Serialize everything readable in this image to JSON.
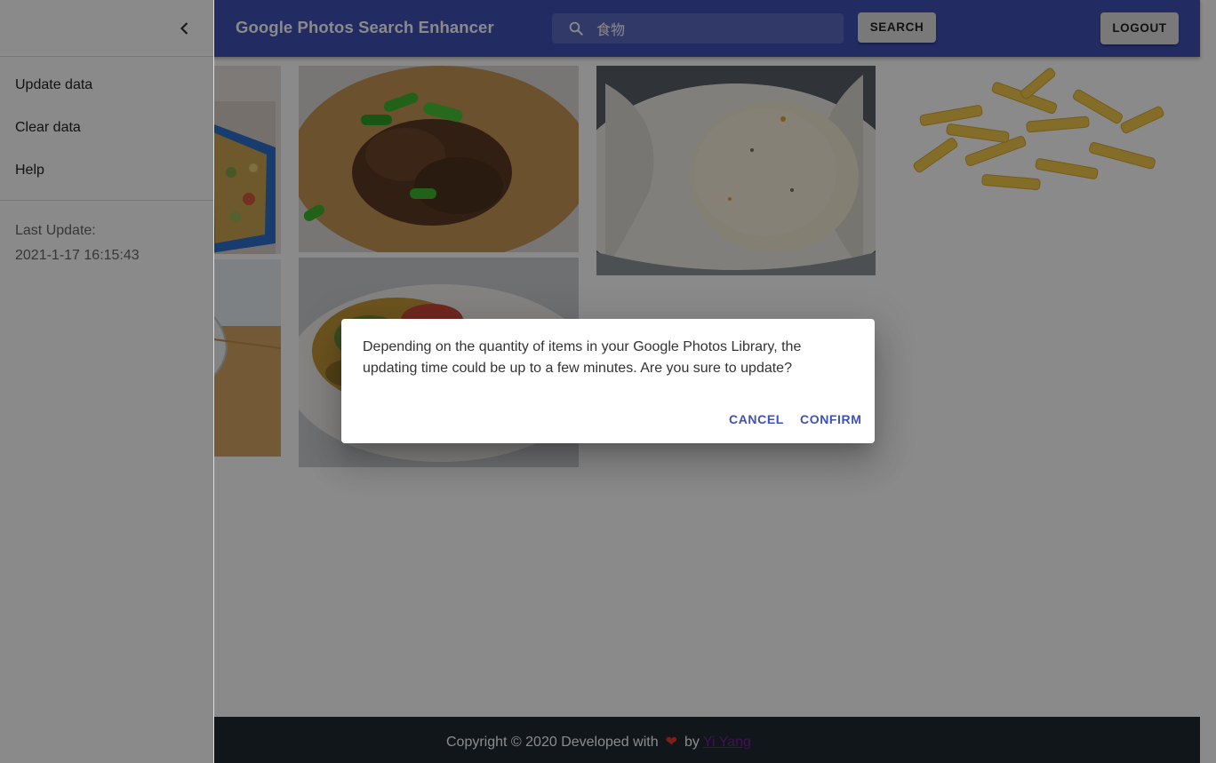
{
  "appbar": {
    "title": "Google Photos Search Enhancer",
    "search_value": "食物",
    "search_button": "SEARCH",
    "logout_button": "LOGOUT",
    "color": "#3f51b5"
  },
  "drawer": {
    "collapse_icon": "chevron-left-icon",
    "items": [
      {
        "label": "Update data"
      },
      {
        "label": "Clear data"
      },
      {
        "label": "Help"
      }
    ],
    "last_update_label": "Last Update:",
    "last_update_value": "2021-1-17 16:15:43"
  },
  "photos": [
    {
      "subject": "casserole in blue dish"
    },
    {
      "subject": "glazed meat with green onions"
    },
    {
      "subject": "round rice bread on cloth"
    },
    {
      "subject": "penne pasta"
    },
    {
      "subject": "glass bowl on wooden board"
    },
    {
      "subject": "plated roasted vegetables"
    }
  ],
  "dialog": {
    "message": "Depending on the quantity of items in your Google Photos Library, the updating time could be up to a few minutes. Are you sure to update?",
    "cancel_label": "CANCEL",
    "confirm_label": "CONFIRM"
  },
  "footer": {
    "text_before": "Copyright © 2020 Developed with",
    "heart": "❤",
    "text_by": "by",
    "author_link": "Yi Yang"
  }
}
